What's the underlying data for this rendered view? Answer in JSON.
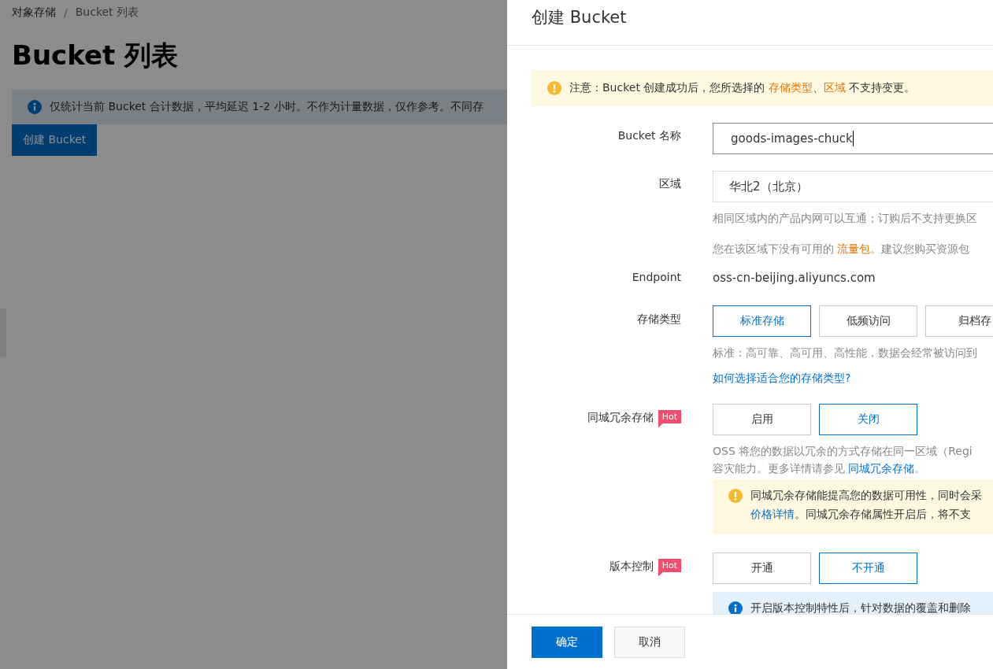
{
  "page": {
    "breadcrumb": [
      "对象存储",
      "Bucket 列表"
    ],
    "breadcrumb_separator": "/",
    "title": "Bucket 列表",
    "notice": "仅统计当前 Bucket 合计数据，平均延迟 1-2 小时。不作为计量数据，仅作参考。不同存",
    "create_button": "创建 Bucket"
  },
  "drawer": {
    "title": "创建 Bucket",
    "warning": "注意：Bucket 创建成功后，您所选择的 **存储类型**、**区域** 不支持变更。",
    "fields": [
      {
        "kind": "input",
        "label": "Bucket 名称",
        "value": "goods-images-chuck"
      },
      {
        "kind": "select",
        "label": "区域",
        "value": "华北2（北京）",
        "notes": [
          {
            "kind": "hint",
            "text": "相同区域内的产品内网可以互通；订购后不支持更换区"
          },
          {
            "kind": "hint",
            "text": "您在该区域下没有可用的 **流量包**。建议您购买资源包"
          }
        ]
      },
      {
        "kind": "text",
        "label": "Endpoint",
        "value": "oss-cn-beijing.aliyuncs.com"
      },
      {
        "kind": "options",
        "label": "存储类型",
        "options": [
          {
            "label": "标准存储",
            "selected": true
          },
          {
            "label": "低频访问",
            "selected": false
          },
          {
            "label": "归档存",
            "selected": false
          }
        ],
        "notes": [
          {
            "kind": "hint",
            "text": "标准：高可靠、高可用、高性能，数据会经常被访问到"
          },
          {
            "kind": "link",
            "text": "如何选择适合您的存储类型?"
          }
        ]
      },
      {
        "kind": "options",
        "label": "同城冗余存储",
        "badge": "Hot",
        "options": [
          {
            "label": "启用",
            "selected": false
          },
          {
            "label": "关闭",
            "selected": true
          }
        ],
        "notes": [
          {
            "kind": "hint",
            "text": "OSS 将您的数据以冗余的方式存储在同一区域（Regi"
          },
          {
            "kind": "hint",
            "text": "容灾能力。更多详情请参见 **同城冗余存储**。"
          },
          {
            "kind": "warning",
            "lines": [
              "同城冗余存储能提高您的数据可用性，同时会采",
              "**价格详情**。同城冗余存储属性开启后，将不支"
            ]
          }
        ]
      },
      {
        "kind": "options",
        "label": "版本控制",
        "badge": "Hot",
        "options": [
          {
            "label": "开通",
            "selected": false
          },
          {
            "label": "不开通",
            "selected": true
          }
        ],
        "notes": [
          {
            "kind": "info",
            "lines": [
              "开启版本控制特性后，针对数据的覆盖和删除"
            ]
          }
        ]
      }
    ],
    "buttons": [
      {
        "label": "确定",
        "kind": "primary"
      },
      {
        "label": "取消",
        "kind": "default"
      }
    ]
  }
}
